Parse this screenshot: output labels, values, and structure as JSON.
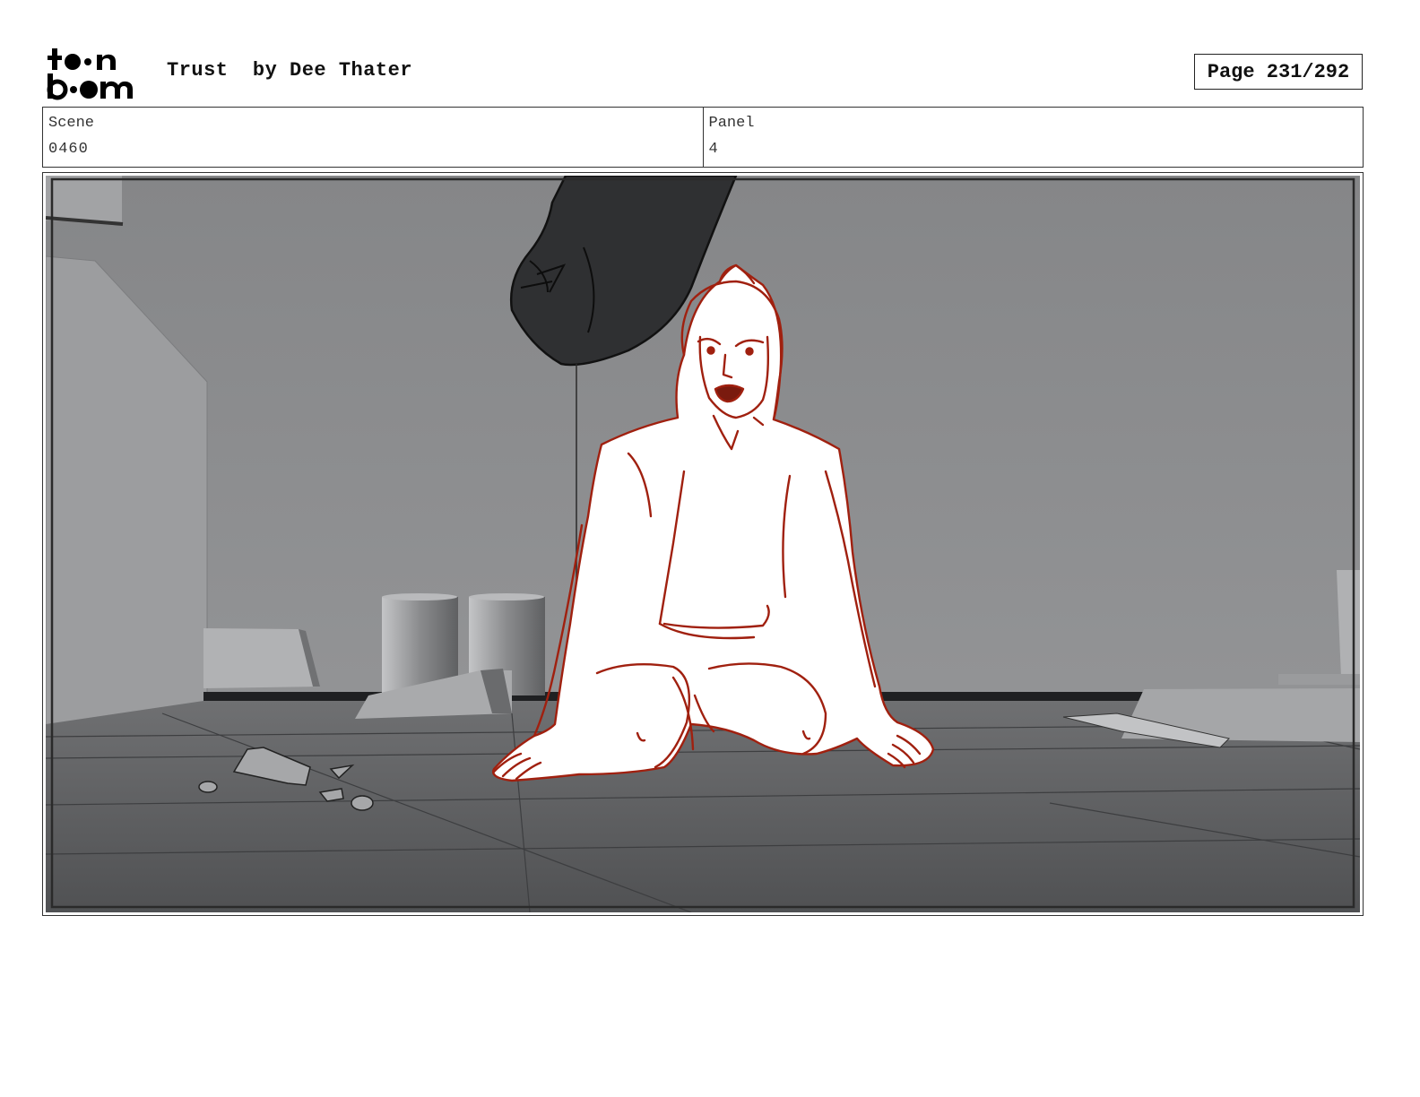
{
  "logo": {
    "line1": "toon",
    "line2": "boom"
  },
  "header": {
    "title": "Trust  by Dee Thater",
    "page": "Page 231/292"
  },
  "info": {
    "scene_label": "Scene",
    "scene_value": "0460",
    "panel_label": "Panel",
    "panel_value": "4"
  },
  "panel_image": {
    "subject": "kneeling-woman-sketch",
    "line_color": "#a0200f",
    "background_color": "#8a8b8d",
    "floor_color": "#5a5b5d"
  }
}
